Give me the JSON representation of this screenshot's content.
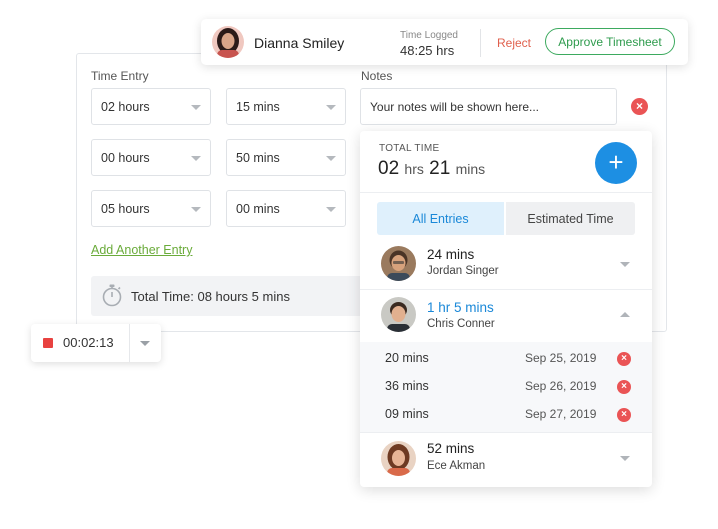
{
  "time_entry": {
    "label": "Time Entry",
    "rows": [
      {
        "hours": "02 hours",
        "mins": "15 mins"
      },
      {
        "hours": "00 hours",
        "mins": "50 mins"
      },
      {
        "hours": "05 hours",
        "mins": "00 mins"
      }
    ],
    "add_link": "Add Another Entry",
    "total": "Total Time: 08 hours 5 mins"
  },
  "notes": {
    "label": "Notes",
    "value": "Your notes will be shown here..."
  },
  "user_card": {
    "name": "Dianna Smiley",
    "time_logged_label": "Time Logged",
    "time_logged_value": "48:25 hrs",
    "reject_label": "Reject",
    "approve_label": "Approve Timesheet"
  },
  "timer": {
    "value": "00:02:13",
    "status_color": "#e84240"
  },
  "panel": {
    "total_label": "TOTAL TIME",
    "total_hours": "02",
    "total_hours_unit": "hrs",
    "total_mins": "21",
    "total_mins_unit": "mins",
    "add_icon": "plus-icon",
    "tabs": [
      {
        "label": "All Entries",
        "active": true
      },
      {
        "label": "Estimated Time",
        "active": false
      }
    ],
    "entries": [
      {
        "duration": "24 mins",
        "name": "Jordan Singer",
        "expanded": false
      },
      {
        "duration": "1 hr 5 mins",
        "name": "Chris Conner",
        "expanded": true,
        "sub_entries": [
          {
            "duration": "20 mins",
            "date": "Sep 25, 2019"
          },
          {
            "duration": "36 mins",
            "date": "Sep 26, 2019"
          },
          {
            "duration": "09 mins",
            "date": "Sep 27, 2019"
          }
        ]
      },
      {
        "duration": "52 mins",
        "name": "Ece Akman",
        "expanded": false
      }
    ]
  },
  "colors": {
    "accent_blue": "#1d8fe3",
    "approve_green": "#3daa5f",
    "reject_red": "#e0604d",
    "link_green": "#6aab3a",
    "delete_red": "#ea5455"
  }
}
